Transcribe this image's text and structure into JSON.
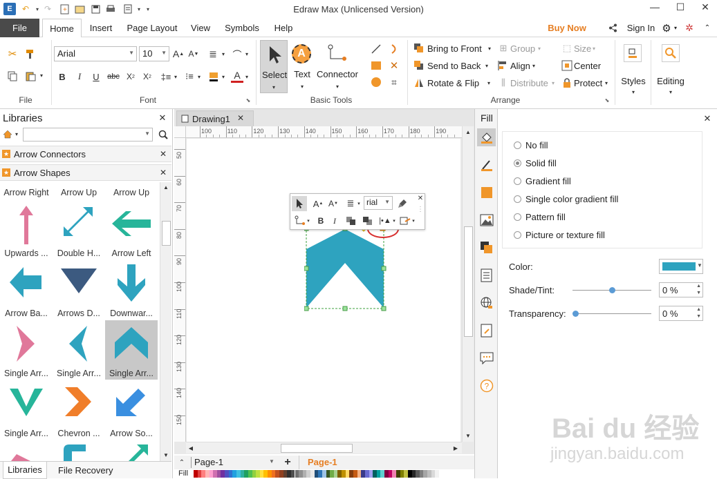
{
  "window": {
    "title": "Edraw Max (Unlicensed Version)",
    "minimize": "—",
    "maximize": "☐",
    "close": "✕"
  },
  "menu": {
    "file": "File",
    "tabs": [
      "Home",
      "Insert",
      "Page Layout",
      "View",
      "Symbols",
      "Help"
    ],
    "buy_now": "Buy Now",
    "sign_in": "Sign In"
  },
  "ribbon": {
    "groups": {
      "file": "File",
      "font": "Font",
      "basic_tools": "Basic Tools",
      "arrange": "Arrange"
    },
    "font_name": "Arial",
    "font_size": "10",
    "select": "Select",
    "text": "Text",
    "connector": "Connector",
    "bring_to_front": "Bring to Front",
    "send_to_back": "Send to Back",
    "rotate_flip": "Rotate & Flip",
    "group": "Group",
    "align": "Align",
    "distribute": "Distribute",
    "size": "Size",
    "center": "Center",
    "protect": "Protect",
    "styles": "Styles",
    "editing": "Editing"
  },
  "libraries": {
    "title": "Libraries",
    "search_placeholder": "",
    "sections": [
      "Arrow Connectors",
      "Arrow Shapes"
    ],
    "shapes": [
      {
        "label": "Arrow Right",
        "icon": "none"
      },
      {
        "label": "Arrow Up",
        "icon": "none"
      },
      {
        "label": "Arrow Up",
        "icon": "none"
      },
      {
        "label": "Upwards ...",
        "icon": "upwards-arrow"
      },
      {
        "label": "Double H...",
        "icon": "double-head-arrow"
      },
      {
        "label": "Arrow Left",
        "icon": "arrow-left"
      },
      {
        "label": "Arrow Ba...",
        "icon": "arrow-back"
      },
      {
        "label": "Arrows D...",
        "icon": "arrows-down-triangle"
      },
      {
        "label": "Downwar...",
        "icon": "downward-arrow"
      },
      {
        "label": "Single Arr...",
        "icon": "single-arrow-right"
      },
      {
        "label": "Single Arr...",
        "icon": "single-arrow-left"
      },
      {
        "label": "Single Arr...",
        "icon": "single-arrow-up"
      },
      {
        "label": "Single Arr...",
        "icon": "single-arrow-down"
      },
      {
        "label": "Chevron ...",
        "icon": "chevron-right"
      },
      {
        "label": "Arrow So...",
        "icon": "arrow-southwest"
      }
    ],
    "bottom_tabs": [
      "Libraries",
      "File Recovery"
    ]
  },
  "canvas": {
    "doc_tab": "Drawing1",
    "ruler_h": [
      "100",
      "110",
      "120",
      "130",
      "140",
      "150",
      "160",
      "170",
      "180",
      "190"
    ],
    "ruler_v": [
      "50",
      "60",
      "70",
      "80",
      "90",
      "100",
      "110",
      "120",
      "130",
      "140",
      "150",
      "160"
    ],
    "mini_font": "rial",
    "shape_color": "#2ea3bf",
    "page_select": "Page-1",
    "page_tab": "Page-1",
    "fill_label": "Fill"
  },
  "fill_panel": {
    "title": "Fill",
    "options": [
      "No fill",
      "Solid fill",
      "Gradient fill",
      "Single color gradient fill",
      "Pattern fill",
      "Picture or texture fill"
    ],
    "selected": "Solid fill",
    "color_label": "Color:",
    "color_value": "#2ea3bf",
    "shade_label": "Shade/Tint:",
    "shade_value": "0 %",
    "transparency_label": "Transparency:",
    "transparency_value": "0 %"
  },
  "watermark": {
    "brand": "Bai du 经验",
    "url": "jingyan.baidu.com"
  }
}
